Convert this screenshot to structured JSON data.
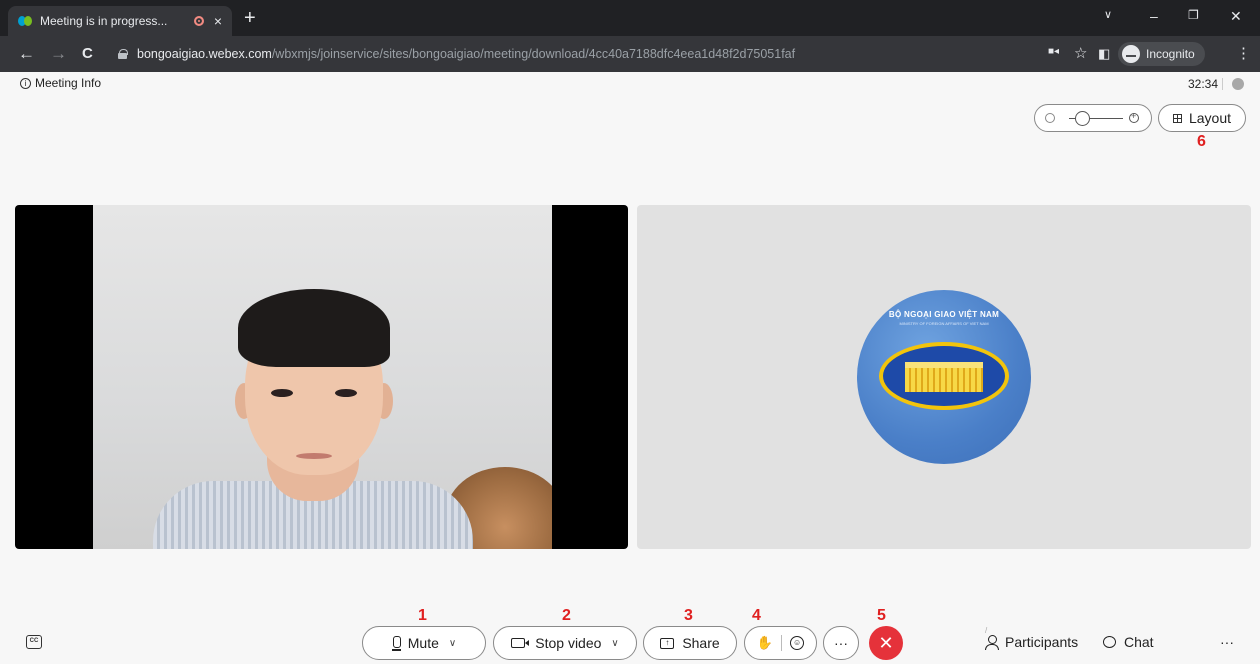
{
  "browser": {
    "tab_title": "Meeting is in progress...",
    "tab_close": "×",
    "new_tab": "+",
    "url_host": "bongoaigiao.webex.com",
    "url_path": "/wbxmjs/joinservice/sites/bongoaigiao/meeting/download/4cc40a7188dfc4eea1d48f2d75051faf",
    "incognito_label": "Incognito",
    "back": "←",
    "forward": "→",
    "reload": "C",
    "star": "☆",
    "menu": "⋮",
    "win_min": "–",
    "win_restore": "❐",
    "win_close": "✕",
    "tab_list": "∨"
  },
  "meeting": {
    "info_label": "Meeting Info",
    "timer": "32:34",
    "layout_label": "Layout",
    "zoom_level": 0.25,
    "org_name": "BỘ NGOẠI GIAO VIỆT NAM",
    "org_subtitle": "MINISTRY OF FOREIGN AFFAIRS OF VIET NAM"
  },
  "controls": {
    "mute_label": "Mute",
    "stop_video_label": "Stop video",
    "share_label": "Share",
    "more_label": "···",
    "end_label": "✕",
    "participants_label": "Participants",
    "chat_label": "Chat",
    "overflow_label": "···",
    "cc_label": "CC"
  },
  "annotations": [
    "1",
    "2",
    "3",
    "4",
    "5",
    "6"
  ],
  "colors": {
    "end_call": "#e5323a",
    "annotation": "#e02020",
    "chrome_dark": "#202124"
  }
}
